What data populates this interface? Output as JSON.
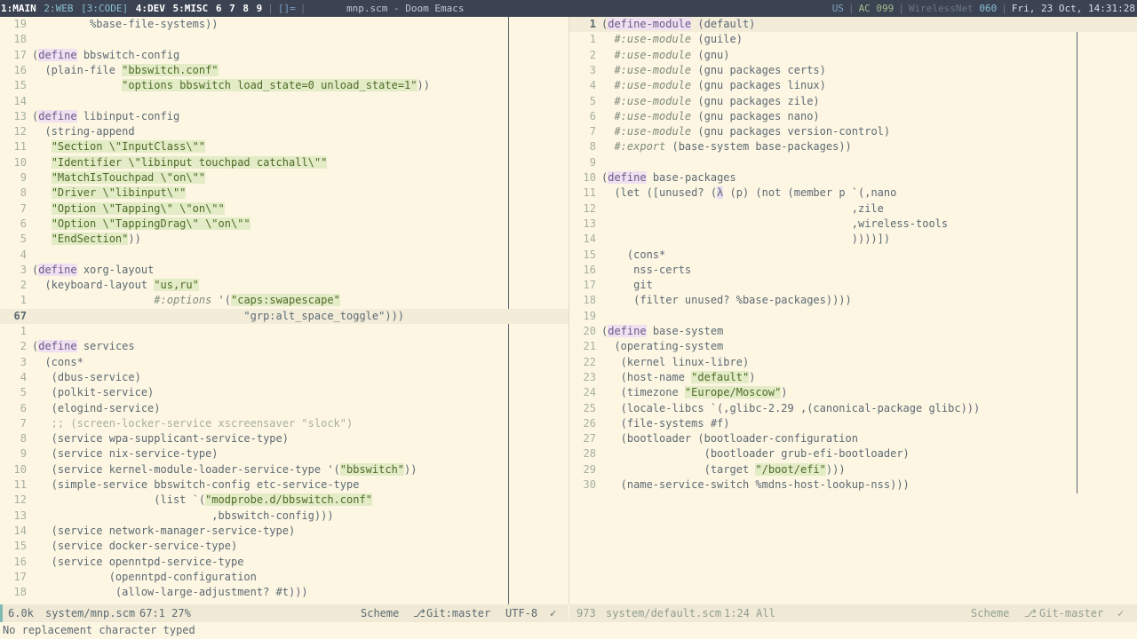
{
  "topbar": {
    "workspaces": [
      {
        "label": "1:MAIN",
        "state": "active"
      },
      {
        "label": "2:WEB",
        "state": "hl"
      },
      {
        "label": "[3:CODE]",
        "state": "hl"
      },
      {
        "label": "4:DEV",
        "state": "active"
      },
      {
        "label": "5:MISC",
        "state": "active"
      },
      {
        "label": "6",
        "state": "active"
      },
      {
        "label": "7",
        "state": "active"
      },
      {
        "label": "8",
        "state": "active"
      },
      {
        "label": "9",
        "state": "active"
      }
    ],
    "layout": "[]=",
    "window_title": "mnp.scm - Doom Emacs",
    "keyboard": "US",
    "battery": "AC 099",
    "network_label": "WirelessNet",
    "network_value": "060",
    "clock": "Fri, 23 Oct, 14:31:28"
  },
  "left_buffer": {
    "lines": [
      {
        "n": "19",
        "t": [
          [
            "code",
            "         %base-file-systems))"
          ]
        ]
      },
      {
        "n": "18",
        "t": []
      },
      {
        "n": "17",
        "t": [
          [
            "code",
            "("
          ],
          [
            "kw",
            "define"
          ],
          [
            "code",
            " bbswitch-config"
          ]
        ]
      },
      {
        "n": "16",
        "t": [
          [
            "code",
            "  (plain-file "
          ],
          [
            "str",
            "\"bbswitch.conf\""
          ]
        ]
      },
      {
        "n": "15",
        "t": [
          [
            "code",
            "              "
          ],
          [
            "str",
            "\"options bbswitch load_state=0 unload_state=1\""
          ],
          [
            "code",
            "))"
          ]
        ]
      },
      {
        "n": "14",
        "t": []
      },
      {
        "n": "13",
        "t": [
          [
            "code",
            "("
          ],
          [
            "kw",
            "define"
          ],
          [
            "code",
            " libinput-config"
          ]
        ]
      },
      {
        "n": "12",
        "t": [
          [
            "code",
            "  (string-append"
          ]
        ]
      },
      {
        "n": "11",
        "t": [
          [
            "code",
            "   "
          ],
          [
            "str",
            "\"Section \\\"InputClass\\\"\""
          ]
        ]
      },
      {
        "n": "10",
        "t": [
          [
            "code",
            "   "
          ],
          [
            "str",
            "\"Identifier \\\"libinput touchpad catchall\\\"\""
          ]
        ]
      },
      {
        "n": "9",
        "t": [
          [
            "code",
            "   "
          ],
          [
            "str",
            "\"MatchIsTouchpad \\\"on\\\"\""
          ]
        ]
      },
      {
        "n": "8",
        "t": [
          [
            "code",
            "   "
          ],
          [
            "str",
            "\"Driver \\\"libinput\\\"\""
          ]
        ]
      },
      {
        "n": "7",
        "t": [
          [
            "code",
            "   "
          ],
          [
            "str",
            "\"Option \\\"Tapping\\\" \\\"on\\\"\""
          ]
        ]
      },
      {
        "n": "6",
        "t": [
          [
            "code",
            "   "
          ],
          [
            "str",
            "\"Option \\\"TappingDrag\\\" \\\"on\\\"\""
          ]
        ]
      },
      {
        "n": "5",
        "t": [
          [
            "code",
            "   "
          ],
          [
            "str",
            "\"EndSection\""
          ],
          [
            "code",
            "))"
          ]
        ]
      },
      {
        "n": "4",
        "t": []
      },
      {
        "n": "3",
        "t": [
          [
            "code",
            "("
          ],
          [
            "kw",
            "define"
          ],
          [
            "code",
            " xorg-layout"
          ]
        ]
      },
      {
        "n": "2",
        "t": [
          [
            "code",
            "  (keyboard-layout "
          ],
          [
            "str",
            "\"us,ru\""
          ]
        ]
      },
      {
        "n": "1",
        "t": [
          [
            "code",
            "                   "
          ],
          [
            "kwd",
            "#:options"
          ],
          [
            "code",
            " '("
          ],
          [
            "str",
            "\"caps:swapescape\""
          ]
        ]
      },
      {
        "n": "67",
        "cur": true,
        "t": [
          [
            "code",
            "                                 \"grp:alt_space_toggle\")))"
          ]
        ]
      },
      {
        "n": "1",
        "t": []
      },
      {
        "n": "2",
        "t": [
          [
            "code",
            "("
          ],
          [
            "kw",
            "define"
          ],
          [
            "code",
            " services"
          ]
        ]
      },
      {
        "n": "3",
        "t": [
          [
            "code",
            "  (cons*"
          ]
        ]
      },
      {
        "n": "4",
        "t": [
          [
            "code",
            "   (dbus-service)"
          ]
        ]
      },
      {
        "n": "5",
        "t": [
          [
            "code",
            "   (polkit-service)"
          ]
        ]
      },
      {
        "n": "6",
        "t": [
          [
            "code",
            "   (elogind-service)"
          ]
        ]
      },
      {
        "n": "7",
        "t": [
          [
            "cmt",
            "   ;; (screen-locker-service xscreensaver \"slock\")"
          ]
        ]
      },
      {
        "n": "8",
        "t": [
          [
            "code",
            "   (service wpa-supplicant-service-type)"
          ]
        ]
      },
      {
        "n": "9",
        "t": [
          [
            "code",
            "   (service nix-service-type)"
          ]
        ]
      },
      {
        "n": "10",
        "t": [
          [
            "code",
            "   (service kernel-module-loader-service-type '("
          ],
          [
            "str",
            "\"bbswitch\""
          ],
          [
            "code",
            "))"
          ]
        ]
      },
      {
        "n": "11",
        "t": [
          [
            "code",
            "   (simple-service bbswitch-config etc-service-type"
          ]
        ]
      },
      {
        "n": "12",
        "t": [
          [
            "code",
            "                   (list `("
          ],
          [
            "str",
            "\"modprobe.d/bbswitch.conf\""
          ]
        ]
      },
      {
        "n": "13",
        "t": [
          [
            "code",
            "                            ,bbswitch-config)))"
          ]
        ]
      },
      {
        "n": "14",
        "t": [
          [
            "code",
            "   (service network-manager-service-type)"
          ]
        ]
      },
      {
        "n": "15",
        "t": [
          [
            "code",
            "   (service docker-service-type)"
          ]
        ]
      },
      {
        "n": "16",
        "t": [
          [
            "code",
            "   (service openntpd-service-type"
          ]
        ]
      },
      {
        "n": "17",
        "t": [
          [
            "code",
            "            (openntpd-configuration"
          ]
        ]
      },
      {
        "n": "18",
        "t": [
          [
            "code",
            "             (allow-large-adjustment? #t)))"
          ]
        ]
      }
    ]
  },
  "right_buffer": {
    "lines": [
      {
        "n": "1",
        "cur": true,
        "t": [
          [
            "code",
            "("
          ],
          [
            "kw",
            "define-module"
          ],
          [
            "code",
            " (default)"
          ]
        ]
      },
      {
        "n": "1",
        "t": [
          [
            "code",
            "  "
          ],
          [
            "kwd",
            "#:use-module"
          ],
          [
            "code",
            " (guile)"
          ]
        ]
      },
      {
        "n": "2",
        "t": [
          [
            "code",
            "  "
          ],
          [
            "kwd",
            "#:use-module"
          ],
          [
            "code",
            " (gnu)"
          ]
        ]
      },
      {
        "n": "3",
        "t": [
          [
            "code",
            "  "
          ],
          [
            "kwd",
            "#:use-module"
          ],
          [
            "code",
            " (gnu packages certs)"
          ]
        ]
      },
      {
        "n": "4",
        "t": [
          [
            "code",
            "  "
          ],
          [
            "kwd",
            "#:use-module"
          ],
          [
            "code",
            " (gnu packages linux)"
          ]
        ]
      },
      {
        "n": "5",
        "t": [
          [
            "code",
            "  "
          ],
          [
            "kwd",
            "#:use-module"
          ],
          [
            "code",
            " (gnu packages zile)"
          ]
        ]
      },
      {
        "n": "6",
        "t": [
          [
            "code",
            "  "
          ],
          [
            "kwd",
            "#:use-module"
          ],
          [
            "code",
            " (gnu packages nano)"
          ]
        ]
      },
      {
        "n": "7",
        "t": [
          [
            "code",
            "  "
          ],
          [
            "kwd",
            "#:use-module"
          ],
          [
            "code",
            " (gnu packages version-control)"
          ]
        ]
      },
      {
        "n": "8",
        "t": [
          [
            "code",
            "  "
          ],
          [
            "kwd",
            "#:export"
          ],
          [
            "code",
            " (base-system base-packages))"
          ]
        ]
      },
      {
        "n": "9",
        "t": []
      },
      {
        "n": "10",
        "t": [
          [
            "code",
            "("
          ],
          [
            "kw",
            "define"
          ],
          [
            "code",
            " base-packages"
          ]
        ]
      },
      {
        "n": "11",
        "t": [
          [
            "code",
            "  (let ([unused? ("
          ],
          [
            "lam",
            "λ"
          ],
          [
            "code",
            " (p) (not (member p `(,nano"
          ]
        ]
      },
      {
        "n": "12",
        "t": [
          [
            "code",
            "                                       ,zile"
          ]
        ]
      },
      {
        "n": "13",
        "t": [
          [
            "code",
            "                                       ,wireless-tools"
          ]
        ]
      },
      {
        "n": "14",
        "t": [
          [
            "code",
            "                                       ))))])"
          ]
        ]
      },
      {
        "n": "15",
        "t": [
          [
            "code",
            "    (cons*"
          ]
        ]
      },
      {
        "n": "16",
        "t": [
          [
            "code",
            "     nss-certs"
          ]
        ]
      },
      {
        "n": "17",
        "t": [
          [
            "code",
            "     git"
          ]
        ]
      },
      {
        "n": "18",
        "t": [
          [
            "code",
            "     (filter unused? %base-packages))))"
          ]
        ]
      },
      {
        "n": "19",
        "t": []
      },
      {
        "n": "20",
        "t": [
          [
            "code",
            "("
          ],
          [
            "kw",
            "define"
          ],
          [
            "code",
            " base-system"
          ]
        ]
      },
      {
        "n": "21",
        "t": [
          [
            "code",
            "  (operating-system"
          ]
        ]
      },
      {
        "n": "22",
        "t": [
          [
            "code",
            "   (kernel linux-libre)"
          ]
        ]
      },
      {
        "n": "23",
        "t": [
          [
            "code",
            "   (host-name "
          ],
          [
            "str",
            "\"default\""
          ],
          [
            "code",
            ")"
          ]
        ]
      },
      {
        "n": "24",
        "t": [
          [
            "code",
            "   (timezone "
          ],
          [
            "str",
            "\"Europe/Moscow\""
          ],
          [
            "code",
            ")"
          ]
        ]
      },
      {
        "n": "25",
        "t": [
          [
            "code",
            "   (locale-libcs `(,glibc-2.29 ,(canonical-package glibc)))"
          ]
        ]
      },
      {
        "n": "26",
        "t": [
          [
            "code",
            "   (file-systems #f)"
          ]
        ]
      },
      {
        "n": "27",
        "t": [
          [
            "code",
            "   (bootloader (bootloader-configuration"
          ]
        ]
      },
      {
        "n": "28",
        "t": [
          [
            "code",
            "                (bootloader grub-efi-bootloader)"
          ]
        ]
      },
      {
        "n": "29",
        "t": [
          [
            "code",
            "                (target "
          ],
          [
            "str",
            "\"/boot/efi\""
          ],
          [
            "code",
            ")))"
          ]
        ]
      },
      {
        "n": "30",
        "t": [
          [
            "code",
            "   (name-service-switch %mdns-host-lookup-nss)))"
          ]
        ]
      }
    ]
  },
  "modeline_left": {
    "size": "6.0k",
    "file": "system/mnp.scm",
    "position": "67:1 27%",
    "mode": "Scheme",
    "vcs": "Git:master",
    "encoding": "UTF-8",
    "status_icon": "check-icon"
  },
  "modeline_right": {
    "size": "973",
    "file": "system/default.scm",
    "position": "1:24 All",
    "mode": "Scheme",
    "vcs": "Git-master",
    "status_icon": "check-icon"
  },
  "echo_area": "No replacement character typed"
}
